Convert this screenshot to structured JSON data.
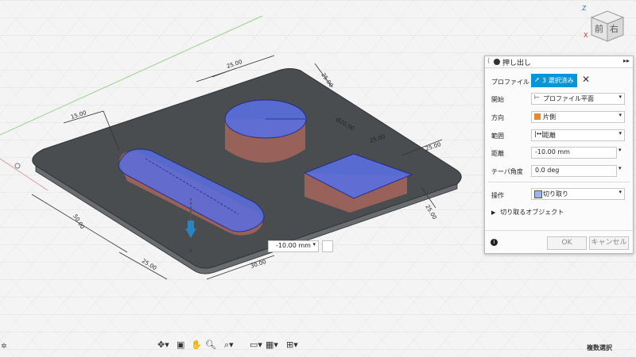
{
  "dialog": {
    "title": "押し出し",
    "profile": {
      "label": "プロファイル",
      "selection": "3 選択済み"
    },
    "start": {
      "label": "開始",
      "value": "プロファイル平面"
    },
    "direction": {
      "label": "方向",
      "value": "片側"
    },
    "extent": {
      "label": "範囲",
      "value": "距離"
    },
    "distance": {
      "label": "距離",
      "value": "-10.00 mm"
    },
    "taper": {
      "label": "テーパ角度",
      "value": "0.0 deg"
    },
    "operation": {
      "label": "操作",
      "value": "切り取り"
    },
    "objects_to_cut": "切り取るオブジェクト",
    "ok": "OK",
    "cancel": "キャンセル"
  },
  "viewcube": {
    "front": "前",
    "right": "右",
    "axis_z": "Z",
    "axis_x": "X"
  },
  "canvas": {
    "distance_input": "-10.00 mm",
    "dimensions": [
      "25.00",
      "25.00",
      "15.00",
      "50.00",
      "25.00",
      "30.00",
      "25.00",
      "25.00",
      "Ø20.00",
      "25.00"
    ]
  },
  "status": {
    "multi_select": "複数選択"
  },
  "colors": {
    "accent": "#0696d7",
    "plate": "#4a4d4f",
    "cut_blue": "#5a6fe0",
    "cut_red": "#c96a60"
  }
}
